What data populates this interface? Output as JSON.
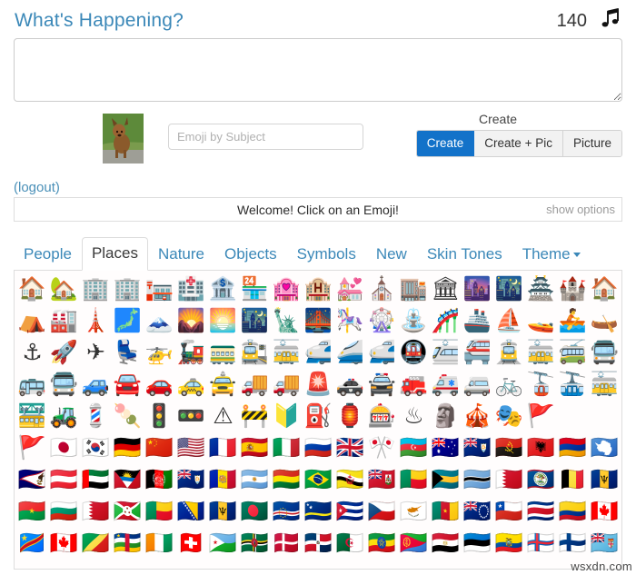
{
  "header": {
    "title": "What's Happening?",
    "char_count": "140",
    "music_icon": "music-note-icon",
    "music_glyph": "♫"
  },
  "composer": {
    "value": "",
    "placeholder": ""
  },
  "action_row": {
    "ghost_text": "",
    "avatar_alt": "user avatar photo of a dog",
    "subject_input": {
      "value": "",
      "placeholder": "Emoji by Subject"
    },
    "create_label": "Create",
    "buttons": [
      {
        "label": "Create",
        "primary": true
      },
      {
        "label": "Create + Pic",
        "primary": false
      },
      {
        "label": "Picture",
        "primary": false
      }
    ]
  },
  "logout": {
    "label": "(logout)"
  },
  "status": {
    "message": "Welcome! Click on an Emoji!",
    "options_link": "show options"
  },
  "tabs": [
    {
      "label": "People",
      "active": false
    },
    {
      "label": "Places",
      "active": true
    },
    {
      "label": "Nature",
      "active": false
    },
    {
      "label": "Objects",
      "active": false
    },
    {
      "label": "Symbols",
      "active": false
    },
    {
      "label": "New",
      "active": false
    },
    {
      "label": "Skin Tones",
      "active": false
    },
    {
      "label": "Theme",
      "active": false,
      "caret": true
    }
  ],
  "emoji_grid": {
    "columns": 19,
    "rows": [
      [
        "🏠",
        "🏡",
        "🏢",
        "🏢",
        "🏣",
        "🏥",
        "🏦",
        "🏪",
        "🏩",
        "🏨",
        "💒",
        "⛪",
        "🏬",
        "🏛",
        "🌆",
        "🌃",
        "🏯",
        "🏰",
        "🏠"
      ],
      [
        "⛺",
        "🏭",
        "🗼",
        "🗾",
        "🗻",
        "🌄",
        "🌅",
        "🌃",
        "🗽",
        "🌉",
        "🎠",
        "🎡",
        "⛲",
        "🎢",
        "🚢",
        "⛵",
        "🚤",
        "🚣",
        "🛶"
      ],
      [
        "⚓",
        "🚀",
        "✈",
        "💺",
        "🚁",
        "🚂",
        "🚃",
        "🚉",
        "🚋",
        "🚅",
        "🚄",
        "🚅",
        "🚇",
        "🚈",
        "🚝",
        "🚊",
        "🚋",
        "🚎",
        "🚍"
      ],
      [
        "🚌",
        "🚍",
        "🚙",
        "🚘",
        "🚗",
        "🚕",
        "🚖",
        "🚚",
        "🚚",
        "🚨",
        "🚓",
        "🚔",
        "🚒",
        "🚑",
        "🚐",
        "🚲",
        "🚡",
        "🚠",
        "🚋"
      ],
      [
        "🚟",
        "🚜",
        "💈",
        "🍡",
        "🚦",
        "🚥",
        "⚠",
        "🚧",
        "🔰",
        "⛽",
        "🏮",
        "🎰",
        "♨",
        "🗿",
        "🎪",
        "🎭",
        "🚩",
        "",
        ""
      ],
      [
        "🚩",
        "🇯🇵",
        "🇰🇷",
        "🇩🇪",
        "🇨🇳",
        "🇺🇸",
        "🇫🇷",
        "🇪🇸",
        "🇮🇹",
        "🇷🇺",
        "🇬🇧",
        "🎌",
        "🇦🇿",
        "🇦🇺",
        "🇦🇮",
        "🇦🇴",
        "🇦🇱",
        "🇦🇲",
        "🇦🇶"
      ],
      [
        "🇦🇸",
        "🇦🇹",
        "🇦🇪",
        "🇦🇬",
        "🇦🇫",
        "🇦🇮",
        "🇦🇩",
        "🇦🇷",
        "🇧🇴",
        "🇧🇷",
        "🇧🇳",
        "🇧🇲",
        "🇧🇯",
        "🇧🇸",
        "🇧🇼",
        "🇧🇭",
        "🇧🇿",
        "🇧🇪",
        "🇧🇧"
      ],
      [
        "🇧🇫",
        "🇧🇬",
        "🇧🇭",
        "🇧🇮",
        "🇧🇯",
        "🇧🇦",
        "🇧🇧",
        "🇧🇩",
        "🇨🇻",
        "🇨🇼",
        "🇨🇺",
        "🇨🇿",
        "🇨🇾",
        "🇨🇲",
        "🇨🇰",
        "🇨🇱",
        "🇨🇷",
        "🇨🇴",
        "🇨🇦"
      ],
      [
        "🇨🇩",
        "🇨🇦",
        "🇨🇬",
        "🇨🇫",
        "🇨🇮",
        "🇨🇭",
        "🇩🇯",
        "🇩🇲",
        "🇩🇰",
        "🇩🇴",
        "🇩🇿",
        "🇪🇹",
        "🇪🇷",
        "🇪🇬",
        "🇪🇪",
        "🇪🇨",
        "🇫🇴",
        "🇫🇮",
        "🇫🇯"
      ]
    ]
  },
  "watermark": {
    "text": "wsxdn.com"
  },
  "colors": {
    "accent_blue": "#3b88b8",
    "primary_button": "#1372c9",
    "border_gray": "#dddddd",
    "muted_text": "#9b9b9b"
  }
}
